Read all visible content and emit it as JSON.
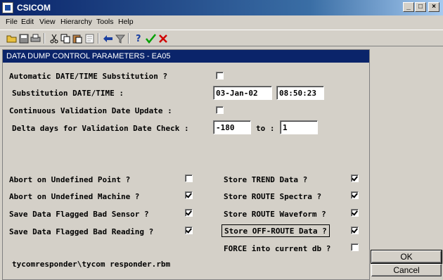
{
  "app": {
    "title": "CSICOM"
  },
  "window_controls": {
    "minimize": "_",
    "maximize": "□",
    "close": "×"
  },
  "menu": [
    "File",
    "Edit",
    "View",
    "Hierarchy",
    "Tools",
    "Help"
  ],
  "toolbar": {
    "icons": [
      "open-icon",
      "save-icon",
      "print-icon",
      "cut-icon",
      "copy-icon",
      "paste-icon",
      "properties-icon",
      "back-arrow-icon",
      "filter-icon",
      "help-icon",
      "check-icon",
      "cancel-x-icon"
    ]
  },
  "panel": {
    "title": "DATA DUMP CONTROL PARAMETERS - EA05",
    "auto_sub_label": "Automatic DATE/TIME Substitution ?",
    "auto_sub_checked": false,
    "sub_datetime_label": "Substitution DATE/TIME :",
    "sub_date": "03-Jan-02",
    "sub_time": "08:50:23",
    "continuous_label": "Continuous Validation Date Update   :",
    "continuous_checked": false,
    "delta_label": "Delta days for Validation Date Check :",
    "delta_from": "-180",
    "delta_to_label": "to :",
    "delta_to": "1",
    "left_options": [
      {
        "label": "Abort on Undefined Point ?",
        "checked": false
      },
      {
        "label": "Abort on Undefined Machine ?",
        "checked": true
      },
      {
        "label": "Save Data Flagged Bad Sensor ?",
        "checked": true
      },
      {
        "label": "Save Data Flagged Bad Reading ?",
        "checked": true
      }
    ],
    "right_options": [
      {
        "label": "Store TREND Data ?",
        "checked": true
      },
      {
        "label": "Store ROUTE Spectra ?",
        "checked": true
      },
      {
        "label": "Store ROUTE Waveform ?",
        "checked": true
      },
      {
        "label": "Store OFF-ROUTE Data ?",
        "checked": true
      },
      {
        "label": "FORCE into current db ?",
        "checked": false
      }
    ],
    "path": "tycomresponder\\tycom responder.rbm"
  },
  "buttons": {
    "ok": "OK",
    "cancel": "Cancel"
  }
}
